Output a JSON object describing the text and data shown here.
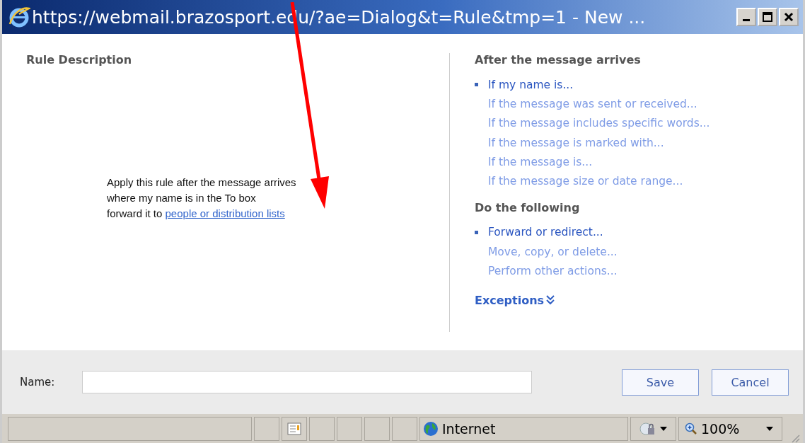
{
  "window": {
    "title": "https://webmail.brazosport.edu/?ae=Dialog&t=Rule&tmp=1 - New ..."
  },
  "rule_description": {
    "heading": "Rule Description",
    "lines": [
      {
        "text": "Apply this rule after the message arrives"
      },
      {
        "text": "where my name is in the To box"
      },
      {
        "text": "forward it to ",
        "link": "people or distribution lists"
      }
    ]
  },
  "sections": [
    {
      "kind": "list",
      "heading": "After the message arrives",
      "items": [
        {
          "label": "If my name is...",
          "selected": true
        },
        {
          "label": "If the message was sent or received...",
          "selected": false
        },
        {
          "label": "If the message includes specific words...",
          "selected": false
        },
        {
          "label": "If the message is marked with...",
          "selected": false
        },
        {
          "label": "If the message is...",
          "selected": false
        },
        {
          "label": "If the message size or date range...",
          "selected": false
        }
      ]
    },
    {
      "kind": "list",
      "heading": "Do the following",
      "items": [
        {
          "label": "Forward or redirect...",
          "selected": true
        },
        {
          "label": "Move, copy, or delete...",
          "selected": false
        },
        {
          "label": "Perform other actions...",
          "selected": false
        }
      ]
    },
    {
      "kind": "expander",
      "heading": "Exceptions",
      "expanded": false
    }
  ],
  "name_field": {
    "label": "Name:"
  },
  "buttons": [
    "Save",
    "Cancel"
  ],
  "status_bar": {
    "zone": "Internet",
    "zoom": "100%"
  }
}
